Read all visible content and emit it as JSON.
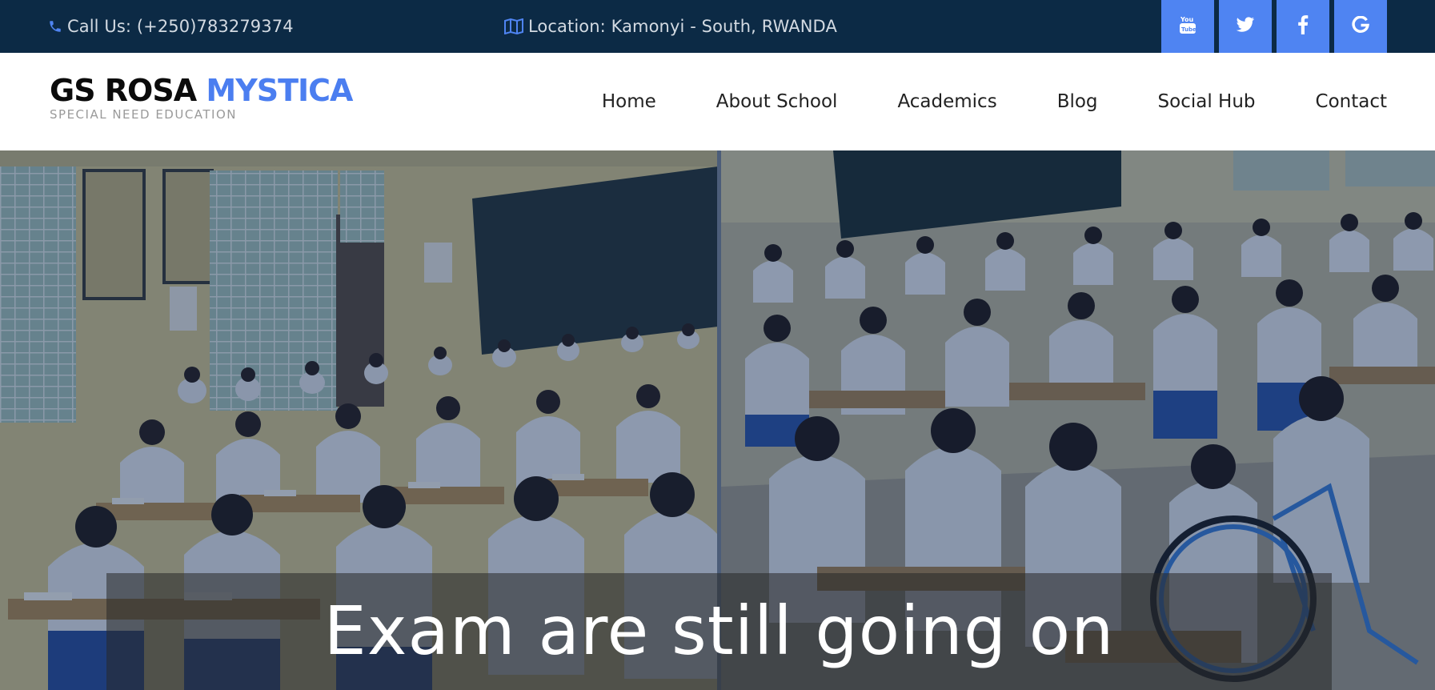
{
  "topbar": {
    "call_text": "Call Us: (+250)783279374",
    "location_text": "Location: Kamonyi - South, RWANDA",
    "social": [
      {
        "icon": "youtube-icon"
      },
      {
        "icon": "twitter-icon"
      },
      {
        "icon": "facebook-icon"
      },
      {
        "icon": "google-icon"
      }
    ]
  },
  "brand": {
    "name_part1": "GS ROSA",
    "name_part2": "MYSTICA",
    "tagline": "SPECIAL NEED EDUCATION"
  },
  "nav": {
    "items": [
      {
        "label": "Home"
      },
      {
        "label": "About School"
      },
      {
        "label": "Academics"
      },
      {
        "label": "Blog"
      },
      {
        "label": "Social Hub"
      },
      {
        "label": "Contact"
      }
    ]
  },
  "hero": {
    "caption": "Exam are still going on"
  },
  "colors": {
    "topbar_bg": "#0c2a45",
    "accent": "#4f84f2",
    "brand_accent": "#4b7ef0"
  }
}
